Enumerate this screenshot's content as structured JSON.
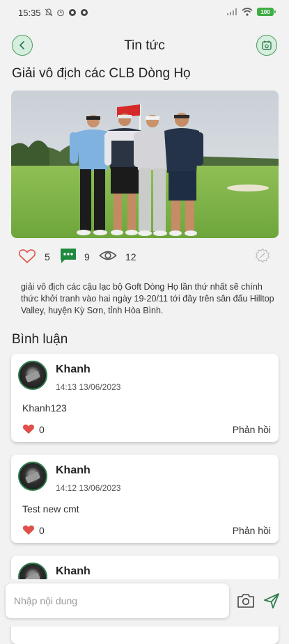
{
  "status": {
    "time": "15:35",
    "battery": "100"
  },
  "header": {
    "title": "Tin tức"
  },
  "article": {
    "title": "Giải vô địch các CLB Dòng Họ",
    "likes": "5",
    "comments": "9",
    "views": "12",
    "body": "giải vô địch các cậu lạc bộ Goft Dòng Họ lần thứ nhất sẽ chính thức khởi tranh vào hai ngày 19-20/11 tới đây trên sân đấu Hilltop Valley, huyện Kỳ Sơn, tỉnh Hòa Bình."
  },
  "comments_section": {
    "title": "Bình luận",
    "items": [
      {
        "name": "Khanh",
        "time": "14:13 13/06/2023",
        "text": "Khanh123",
        "likes": "0",
        "reply": "Phản hồi"
      },
      {
        "name": "Khanh",
        "time": "14:12 13/06/2023",
        "text": "Test new cmt",
        "likes": "0",
        "reply": "Phản hồi"
      },
      {
        "name": "Khanh"
      }
    ]
  },
  "composer": {
    "placeholder": "Nhập nội dung"
  },
  "colors": {
    "accent": "#2e7d4f",
    "heart_red": "#e0504a",
    "chat_green": "#1e8a3e"
  }
}
